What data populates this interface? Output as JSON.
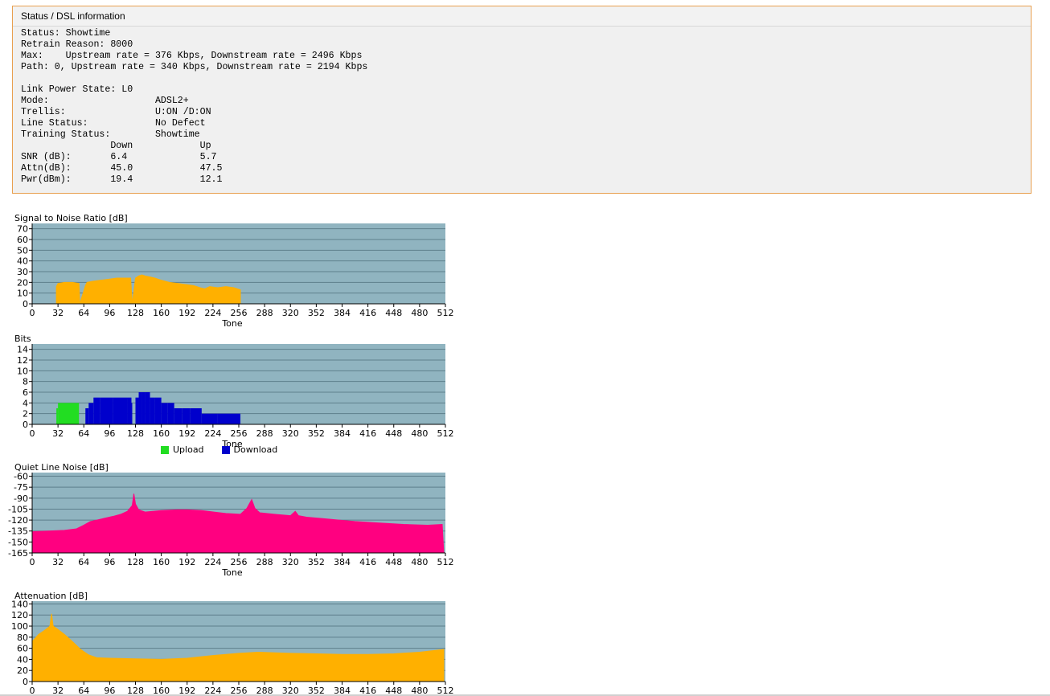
{
  "status_panel": {
    "title": "Status / DSL information",
    "lines": [
      "Status: Showtime",
      "Retrain Reason: 8000",
      "Max:    Upstream rate = 376 Kbps, Downstream rate = 2496 Kbps",
      "Path: 0, Upstream rate = 340 Kbps, Downstream rate = 2194 Kbps",
      "",
      "Link Power State: L0",
      "Mode:                   ADSL2+",
      "Trellis:                U:ON /D:ON",
      "Line Status:            No Defect",
      "Training Status:        Showtime",
      "                Down            Up",
      "SNR (dB):       6.4             5.7",
      "Attn(dB):       45.0            47.5",
      "Pwr(dBm):       19.4            12.1"
    ]
  },
  "legend": {
    "upload_label": "Upload",
    "download_label": "Download",
    "upload_color": "#22dd22",
    "download_color": "#0000cc"
  },
  "chart_data": [
    {
      "id": "snr",
      "type": "area",
      "title": "Signal to Noise Ratio [dB]",
      "xlabel": "Tone",
      "ylabel": "",
      "xlim": [
        0,
        512
      ],
      "ylim": [
        0,
        75
      ],
      "yticks": [
        0,
        10,
        20,
        30,
        40,
        50,
        60,
        70
      ],
      "xticks": [
        0,
        32,
        64,
        96,
        128,
        160,
        192,
        224,
        256,
        288,
        320,
        352,
        384,
        416,
        448,
        480,
        512
      ],
      "grid": true,
      "color": "#ffb000",
      "series": [
        {
          "x": [
            30,
            32,
            40,
            50,
            58,
            59,
            66,
            68,
            75,
            85,
            95,
            105,
            115,
            122,
            124,
            128,
            132,
            136,
            140,
            146,
            152,
            160,
            170,
            180,
            190,
            200,
            208,
            214,
            220,
            230,
            240,
            250,
            258
          ],
          "y": [
            16,
            19,
            20,
            20,
            19,
            0,
            17,
            20,
            21,
            22,
            23,
            24,
            24,
            24,
            0,
            24,
            26,
            27,
            26,
            25,
            24,
            22,
            20,
            19,
            18,
            17,
            15,
            14,
            16,
            15,
            16,
            15,
            13
          ]
        }
      ]
    },
    {
      "id": "bits",
      "type": "bar",
      "title": "Bits",
      "xlabel": "Tone",
      "ylabel": "",
      "xlim": [
        0,
        512
      ],
      "ylim": [
        0,
        15
      ],
      "yticks": [
        0,
        2,
        4,
        6,
        8,
        10,
        12,
        14
      ],
      "xticks": [
        0,
        32,
        64,
        96,
        128,
        160,
        192,
        224,
        256,
        288,
        320,
        352,
        384,
        416,
        448,
        480,
        512
      ],
      "grid": true,
      "series": [
        {
          "name": "Upload",
          "color": "#22dd22",
          "x": [
            30,
            32,
            58
          ],
          "y": [
            3,
            4,
            0
          ]
        },
        {
          "name": "Download",
          "color": "#0000cc",
          "x": [
            66,
            70,
            76,
            84,
            100,
            118,
            123,
            124,
            128,
            132,
            136,
            140,
            146,
            152,
            160,
            168,
            176,
            186,
            196,
            210,
            230,
            258
          ],
          "y": [
            3,
            4,
            5,
            5,
            5,
            5,
            4,
            0,
            5,
            6,
            6,
            6,
            5,
            5,
            4,
            4,
            3,
            3,
            3,
            2,
            2,
            0
          ]
        }
      ]
    },
    {
      "id": "qln",
      "type": "area",
      "title": "Quiet Line Noise [dB]",
      "xlabel": "Tone",
      "ylabel": "",
      "xlim": [
        0,
        512
      ],
      "ylim": [
        -165,
        -55
      ],
      "yticks": [
        -60,
        -75,
        -90,
        -105,
        -120,
        -135,
        -150,
        -165
      ],
      "xticks": [
        0,
        32,
        64,
        96,
        128,
        160,
        192,
        224,
        256,
        288,
        320,
        352,
        384,
        416,
        448,
        480,
        512
      ],
      "grid": true,
      "color": "#ff0080",
      "series": [
        {
          "x": [
            0,
            20,
            40,
            55,
            64,
            72,
            88,
            100,
            110,
            118,
            124,
            126,
            128,
            132,
            140,
            160,
            180,
            192,
            210,
            225,
            240,
            258,
            266,
            272,
            276,
            282,
            300,
            320,
            326,
            330,
            340,
            360,
            380,
            400,
            430,
            460,
            490,
            508,
            510
          ],
          "y": [
            -136,
            -135,
            -134,
            -132,
            -127,
            -122,
            -118,
            -115,
            -112,
            -108,
            -100,
            -84,
            -98,
            -106,
            -109,
            -107,
            -106,
            -106,
            -107,
            -109,
            -111,
            -112,
            -104,
            -92,
            -104,
            -110,
            -112,
            -114,
            -108,
            -114,
            -116,
            -118,
            -120,
            -122,
            -124,
            -126,
            -127,
            -126,
            -165
          ]
        }
      ]
    },
    {
      "id": "attn",
      "type": "area",
      "title": "Attenuation [dB]",
      "xlabel": "",
      "ylabel": "",
      "xlim": [
        0,
        512
      ],
      "ylim": [
        0,
        145
      ],
      "yticks": [
        0,
        20,
        40,
        60,
        80,
        100,
        120,
        140
      ],
      "xticks": [
        0,
        32,
        64,
        96,
        128,
        160,
        192,
        224,
        256,
        288,
        320,
        352,
        384,
        416,
        448,
        480,
        512
      ],
      "grid": true,
      "color": "#ffb000",
      "series": [
        {
          "x": [
            0,
            8,
            16,
            22,
            24,
            26,
            30,
            40,
            50,
            60,
            70,
            80,
            96,
            128,
            160,
            192,
            224,
            256,
            280,
            320,
            352,
            384,
            416,
            448,
            480,
            510
          ],
          "y": [
            72,
            85,
            93,
            100,
            122,
            100,
            96,
            85,
            72,
            58,
            48,
            43,
            42,
            41,
            40,
            42,
            47,
            51,
            53,
            51,
            50,
            49,
            49,
            50,
            53,
            58
          ]
        }
      ]
    }
  ]
}
